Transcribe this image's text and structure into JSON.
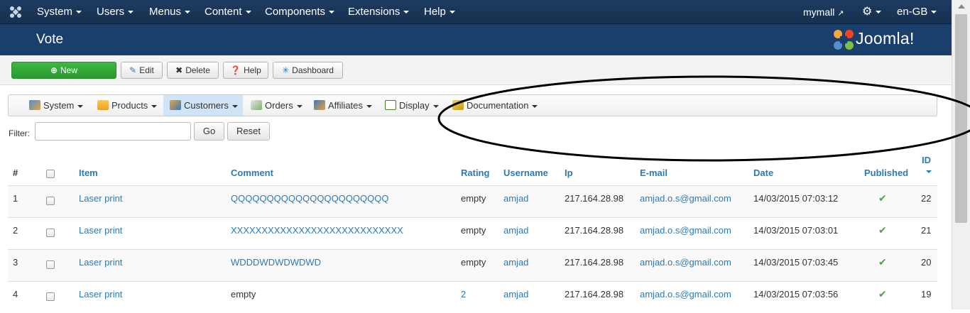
{
  "topbar": {
    "menu": [
      {
        "label": "System"
      },
      {
        "label": "Users"
      },
      {
        "label": "Menus"
      },
      {
        "label": "Content"
      },
      {
        "label": "Components"
      },
      {
        "label": "Extensions"
      },
      {
        "label": "Help"
      }
    ],
    "site_link": "mymall",
    "language": "en-GB"
  },
  "header": {
    "page_title": "Vote",
    "brand_text": "Joomla!"
  },
  "toolbar": {
    "new_label": "New",
    "edit_label": "Edit",
    "delete_label": "Delete",
    "help_label": "Help",
    "dashboard_label": "Dashboard"
  },
  "submenu": [
    {
      "label": "System"
    },
    {
      "label": "Products"
    },
    {
      "label": "Customers"
    },
    {
      "label": "Orders"
    },
    {
      "label": "Affiliates"
    },
    {
      "label": "Display"
    },
    {
      "label": "Documentation"
    }
  ],
  "filter": {
    "label": "Filter:",
    "value": "",
    "go_label": "Go",
    "reset_label": "Reset"
  },
  "table": {
    "headers": {
      "num": "#",
      "item": "Item",
      "comment": "Comment",
      "rating": "Rating",
      "username": "Username",
      "ip": "Ip",
      "email": "E-mail",
      "date": "Date",
      "published": "Published",
      "id": "ID"
    },
    "rows": [
      {
        "num": "1",
        "item": "Laser print",
        "comment": "QQQQQQQQQQQQQQQQQQQQQQ",
        "rating": "empty",
        "username": "amjad",
        "ip": "217.164.28.98",
        "email": "amjad.o.s@gmail.com",
        "date": "14/03/2015 07:03:12",
        "id": "22"
      },
      {
        "num": "2",
        "item": "Laser print",
        "comment": "XXXXXXXXXXXXXXXXXXXXXXXXXXXX",
        "rating": "empty",
        "username": "amjad",
        "ip": "217.164.28.98",
        "email": "amjad.o.s@gmail.com",
        "date": "14/03/2015 07:03:01",
        "id": "21"
      },
      {
        "num": "3",
        "item": "Laser print",
        "comment": "WDDDWDWDWDWD",
        "rating": "empty",
        "username": "amjad",
        "ip": "217.164.28.98",
        "email": "amjad.o.s@gmail.com",
        "date": "14/03/2015 07:03:45",
        "id": "20"
      },
      {
        "num": "4",
        "item": "Laser print",
        "comment": "empty",
        "rating": "2",
        "username": "amjad",
        "ip": "217.164.28.98",
        "email": "amjad.o.s@gmail.com",
        "date": "14/03/2015 07:03:56",
        "id": "19"
      }
    ]
  },
  "colors": {
    "topbar": "#1d3b62",
    "header": "#1a3f6d",
    "link": "#2a7ab7",
    "new_button": "#3fb744",
    "published_check": "#46a546",
    "submenu_active": "#cfe4f6"
  },
  "icons": {
    "joomla_logo": "joomla-logo-icon",
    "external_link": "external-link-icon",
    "settings": "gear-icon",
    "published": "check-icon"
  }
}
